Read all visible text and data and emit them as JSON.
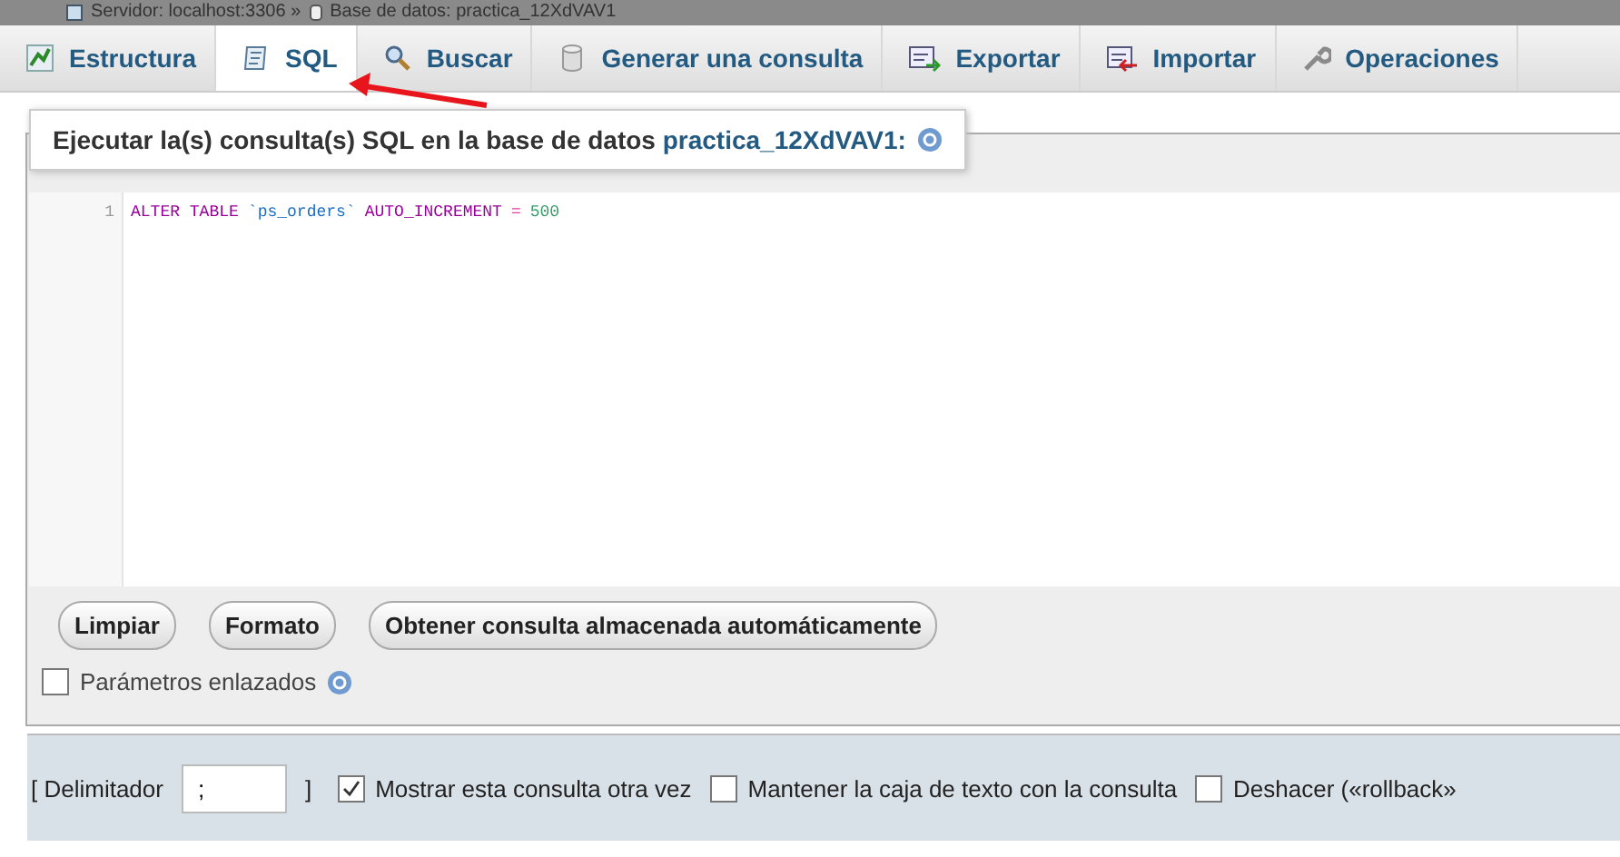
{
  "breadcrumb": [
    {
      "kind": "server",
      "label": "Servidor: localhost:3306 »"
    },
    {
      "kind": "database",
      "label": "Base de datos: practica_12XdVAV1"
    }
  ],
  "tabs": [
    {
      "label": "Estructura",
      "kind": "structure",
      "selected": false
    },
    {
      "label": "SQL",
      "kind": "sql",
      "selected": true
    },
    {
      "label": "Buscar",
      "kind": "search",
      "selected": false
    },
    {
      "label": "Generar una consulta",
      "kind": "query",
      "selected": false
    },
    {
      "label": "Exportar",
      "kind": "export",
      "selected": false
    },
    {
      "label": "Importar",
      "kind": "import",
      "selected": false
    },
    {
      "label": "Operaciones",
      "kind": "operations",
      "selected": false
    }
  ],
  "legend": {
    "text": "Ejecutar la(s) consulta(s) SQL en la base de datos ",
    "link": "practica_12XdVAV1:"
  },
  "editor": {
    "lines": [
      {
        "number": "1",
        "tokens": [
          {
            "kind": "keyword",
            "text": "ALTER TABLE"
          },
          {
            "kind": "identifier",
            "text": "`ps_orders`"
          },
          {
            "kind": "keyword",
            "text": "AUTO_INCREMENT"
          },
          {
            "kind": "operator",
            "text": "="
          },
          {
            "kind": "number",
            "text": "500"
          }
        ]
      }
    ]
  },
  "buttons": [
    "Limpiar",
    "Formato",
    "Obtener consulta almacenada automáticamente"
  ],
  "bind_parameters": {
    "label": "Parámetros enlazados",
    "checked": false
  },
  "footer": {
    "delimiter_label": "[ Delimitador",
    "delimiter_value": ";",
    "delimiter_close": "]",
    "options": [
      {
        "label": "Mostrar esta consulta otra vez",
        "checked": true
      },
      {
        "label": "Mantener la caja de texto con la consulta",
        "checked": false
      },
      {
        "label": "Deshacer («rollback»",
        "checked": false
      }
    ]
  }
}
